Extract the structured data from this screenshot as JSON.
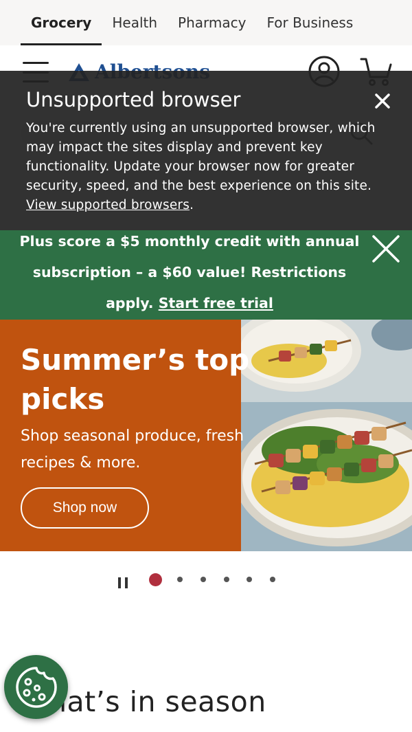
{
  "top_tabs": {
    "items": [
      {
        "label": "Grocery"
      },
      {
        "label": "Health"
      },
      {
        "label": "Pharmacy"
      },
      {
        "label": "For Business"
      }
    ],
    "active": "Grocery"
  },
  "header": {
    "logo_text": "Albertsons"
  },
  "browser_warning": {
    "title": "Unsupported browser",
    "body": "You're currently using an unsupported browser, which may impact the sites display and prevent key functionality. Update your browser now for greater security, speed, and the best experience on this site.",
    "link_text": "View supported browsers",
    "link_suffix": "."
  },
  "promo": {
    "text": "Plus score a $5 monthly credit with annual subscription – a $60 value! Restrictions apply.",
    "link_text": "Start free trial"
  },
  "hero": {
    "title": "Summer’s top picks",
    "description": "Shop seasonal produce, fresh recipes & more.",
    "button_label": "Shop now"
  },
  "carousel": {
    "slide_count": 6,
    "active_index": 0
  },
  "section": {
    "title": "What’s in season"
  },
  "colors": {
    "overlay_bg": "#222222",
    "promo_green": "#2e7045",
    "hero_orange": "#c0530f",
    "active_dot": "#b02f3e",
    "brand_blue": "#1f4f91"
  },
  "icons": {
    "menu": "hamburger-menu-icon",
    "account": "account-icon",
    "cart": "cart-icon",
    "close": "close-icon",
    "pause": "pause-icon",
    "cookie": "cookie-icon"
  }
}
